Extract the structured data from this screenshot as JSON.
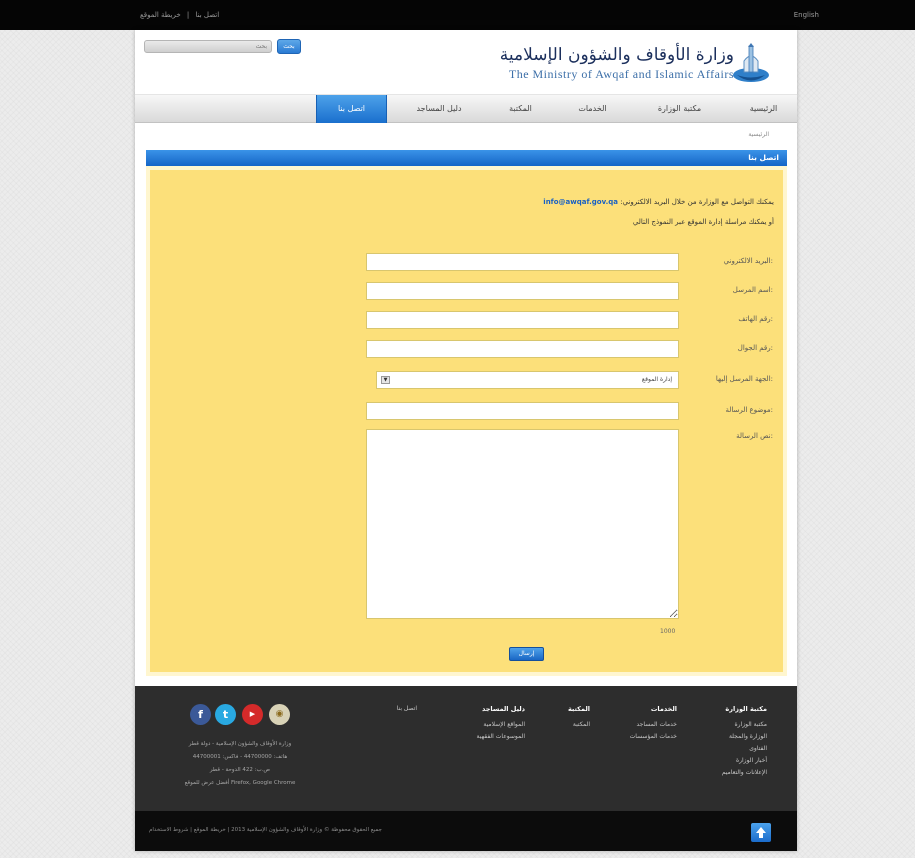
{
  "topbar": {
    "links": [
      "اتصل بنا",
      "|",
      "خريطة الموقع"
    ],
    "language": "English"
  },
  "header": {
    "search_placeholder": "بحث",
    "search_button": "بحث",
    "logo_arabic": "وزارة الأوقاف والشؤون الإسلامية",
    "logo_english": "The Ministry of Awqaf and Islamic Affairs"
  },
  "nav": {
    "items": [
      {
        "label": "الرئيسية"
      },
      {
        "label": "مكتبة الوزارة"
      },
      {
        "label": "الخدمات"
      },
      {
        "label": "المكتبة"
      },
      {
        "label": "دليل المساجد"
      },
      {
        "label": "اتصل بنا"
      }
    ],
    "active_index": 5
  },
  "breadcrumb": "الرئيسية",
  "page": {
    "title": "اتصل بنا",
    "intro_text": "يمكنك التواصل مع الوزارة من خلال البريد الالكتروني:",
    "intro_email": "info@awqaf.gov.qa",
    "intro_text2": "أو يمكنك مراسلة إدارة الموقع عبر النموذج التالي",
    "form": {
      "email_label": "البريد الالكتروني:",
      "name_label": "اسم المرسل:",
      "phone_label": "رقم الهاتف:",
      "mobile_label": "رقم الجوال:",
      "department_label": "الجهة المرسل إليها:",
      "department_value": "إدارة الموقع",
      "subject_label": "موضوع الرسالة:",
      "message_label": "نص الرسالة:",
      "char_note": "1000",
      "send_button": "إرسال"
    }
  },
  "footer": {
    "social": [
      "facebook-icon",
      "twitter-icon",
      "youtube-icon",
      "rss-icon"
    ],
    "info_lines": [
      "وزارة الأوقاف والشؤون الإسلامية - دولة قطر",
      "هاتف: 44700000 - فاكس: 44700001",
      "ص.ب: 422 الدوحة - قطر",
      "أفضل عرض للموقع Firefox, Google Chrome"
    ],
    "columns": [
      {
        "heading": "مكتبة الوزارة",
        "items": [
          "مكتبة الوزارة",
          "الوزارة والمجلة",
          "الفتاوى",
          "أخبار الوزارة",
          "الإعلانات والتعاميم"
        ]
      },
      {
        "heading": "الخدمات",
        "items": [
          "خدمات المساجد",
          "خدمات المؤسسات"
        ]
      },
      {
        "heading": "المكتبة",
        "items": [
          "المكتبة"
        ]
      },
      {
        "heading": "دليل المساجد",
        "items": [
          "المواقع الإسلامية",
          "الموسوعات الفقهية"
        ]
      }
    ],
    "contact_link": "اتصل بنا"
  },
  "bottom": {
    "copyright": "جميع الحقوق محفوظة © وزارة الأوقاف والشؤون الإسلامية 2013   |   خريطة الموقع   |   شروط الاستخدام"
  }
}
